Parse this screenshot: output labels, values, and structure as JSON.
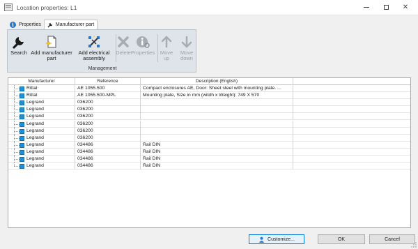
{
  "window": {
    "title": "Location properties: L1"
  },
  "tabs": [
    {
      "label": "Properties",
      "icon": "info-icon"
    },
    {
      "label": "Manufacturer part",
      "icon": "wrench-icon"
    }
  ],
  "ribbon": {
    "group_label": "Management",
    "buttons": {
      "search": {
        "line1": "Search",
        "line2": ""
      },
      "add_manufacturer": {
        "line1": "Add manufacturer",
        "line2": "part"
      },
      "add_electrical": {
        "line1": "Add electrical",
        "line2": "assembly"
      },
      "delete": {
        "line1": "Delete",
        "line2": ""
      },
      "properties": {
        "line1": "Properties",
        "line2": ""
      },
      "move_up": {
        "line1": "Move",
        "line2": "up"
      },
      "move_down": {
        "line1": "Move",
        "line2": "down"
      }
    }
  },
  "grid": {
    "columns": [
      "Manufacturer",
      "Reference",
      "Description (English)"
    ],
    "rows": [
      {
        "manufacturer": "Rittal",
        "reference": "AE 1055.500",
        "description": "Compact enclosures AE,  Door: Sheet steel with mounting plate. ..."
      },
      {
        "manufacturer": "Rittal",
        "reference": "AE 1055.500-MPL",
        "description": "Mounting plate, Size in mm (witdh  x Weight): 749 X 570"
      },
      {
        "manufacturer": "Legrand",
        "reference": "036200",
        "description": ""
      },
      {
        "manufacturer": "Legrand",
        "reference": "036200",
        "description": ""
      },
      {
        "manufacturer": "Legrand",
        "reference": "036200",
        "description": ""
      },
      {
        "manufacturer": "Legrand",
        "reference": "036200",
        "description": ""
      },
      {
        "manufacturer": "Legrand",
        "reference": "036200",
        "description": ""
      },
      {
        "manufacturer": "Legrand",
        "reference": "036200",
        "description": ""
      },
      {
        "manufacturer": "Legrand",
        "reference": "034486",
        "description": "Rail DIN"
      },
      {
        "manufacturer": "Legrand",
        "reference": "034486",
        "description": "Rail DIN"
      },
      {
        "manufacturer": "Legrand",
        "reference": "034486",
        "description": "Rail DIN"
      },
      {
        "manufacturer": "Legrand",
        "reference": "034486",
        "description": "Rail DIN"
      }
    ]
  },
  "footer": {
    "customize_label": "Customize...",
    "ok_label": "OK",
    "cancel_label": "Cancel"
  },
  "colors": {
    "accent": "#0078d7",
    "part_icon": "#1f8fd6",
    "ribbon_bg": "#dfe4ea"
  }
}
